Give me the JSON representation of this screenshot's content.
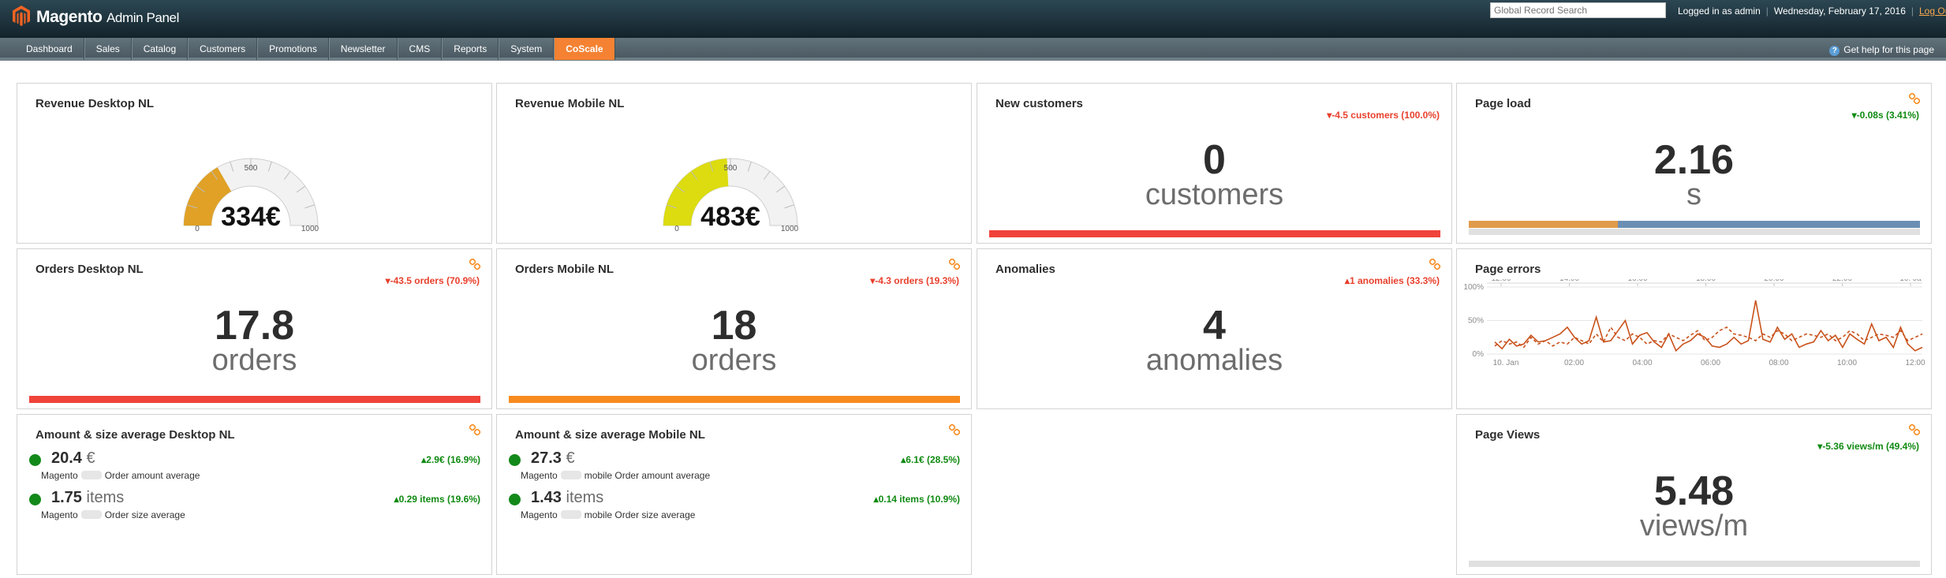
{
  "header": {
    "logo_brand": "Magento",
    "logo_sub": "Admin Panel",
    "search_placeholder": "Global Record Search",
    "logged_in": "Logged in as admin",
    "date": "Wednesday, February 17, 2016",
    "logout": "Log Out"
  },
  "nav": {
    "items": [
      "Dashboard",
      "Sales",
      "Catalog",
      "Customers",
      "Promotions",
      "Newsletter",
      "CMS",
      "Reports",
      "System",
      "CoScale"
    ],
    "active": "CoScale",
    "help": "Get help for this page"
  },
  "colors": {
    "accent": "#f48232",
    "red": "#f0433a",
    "orange": "#f78b1f",
    "green": "#0f8a12",
    "blue": "#6b8fb3"
  },
  "panels": {
    "rev_desktop": {
      "title": "Revenue Desktop NL",
      "value": "334€",
      "min": "0",
      "mid": "500",
      "max": "1000",
      "gauge_value": 334,
      "gauge_max": 1000,
      "color": "#e0a126"
    },
    "rev_mobile": {
      "title": "Revenue Mobile NL",
      "value": "483€",
      "min": "0",
      "mid": "500",
      "max": "1000",
      "gauge_value": 483,
      "gauge_max": 1000,
      "color": "#dcdc10"
    },
    "new_customers": {
      "title": "New customers",
      "delta": "-4.5 customers (100.0%)",
      "value": "0",
      "unit": "customers"
    },
    "page_load": {
      "title": "Page load",
      "delta": "-0.08s (3.41%)",
      "value": "2.16",
      "unit": "s",
      "bar_split": 0.33
    },
    "orders_desktop": {
      "title": "Orders Desktop NL",
      "delta": "-43.5 orders (70.9%)",
      "value": "17.8",
      "unit": "orders"
    },
    "orders_mobile": {
      "title": "Orders Mobile NL",
      "delta": "-4.3 orders (19.3%)",
      "value": "18",
      "unit": "orders"
    },
    "anomalies": {
      "title": "Anomalies",
      "delta": "1 anomalies (33.3%)",
      "value": "4",
      "unit": "anomalies"
    },
    "page_errors": {
      "title": "Page errors"
    },
    "amount_desktop": {
      "title": "Amount & size average Desktop NL",
      "rows": [
        {
          "value": "20.4",
          "unit": "€",
          "label_a": "Magento",
          "label_b": "Order amount average",
          "delta": "2.9€ (16.9%)"
        },
        {
          "value": "1.75",
          "unit": "items",
          "label_a": "Magento",
          "label_b": "Order size average",
          "delta": "0.29 items (19.6%)"
        }
      ]
    },
    "amount_mobile": {
      "title": "Amount & size average Mobile NL",
      "rows": [
        {
          "value": "27.3",
          "unit": "€",
          "label_a": "Magento",
          "label_b": "mobile Order amount average",
          "delta": "6.1€ (28.5%)"
        },
        {
          "value": "1.43",
          "unit": "items",
          "label_a": "Magento",
          "label_b": "mobile Order size average",
          "delta": "0.14 items (10.9%)"
        }
      ]
    },
    "page_views": {
      "title": "Page Views",
      "delta": "-5.36 views/m (49.4%)",
      "value": "5.48",
      "unit": "views/m"
    }
  },
  "chart_data": {
    "type": "line",
    "x_top_ticks": [
      "12:00",
      "14:00",
      "16:00",
      "18:00",
      "20:00",
      "22:00",
      "10. Ja"
    ],
    "x_bottom_ticks": [
      "10. Jan",
      "02:00",
      "04:00",
      "06:00",
      "08:00",
      "10:00",
      "12:00"
    ],
    "y_ticks": [
      "100%",
      "50%",
      "0%"
    ],
    "ylim": [
      0,
      100
    ],
    "series": [
      {
        "style": "solid",
        "color": "#c9521b",
        "values": [
          18,
          8,
          22,
          12,
          15,
          28,
          18,
          20,
          25,
          30,
          40,
          25,
          15,
          20,
          55,
          18,
          20,
          35,
          50,
          15,
          28,
          32,
          18,
          10,
          30,
          5,
          15,
          20,
          30,
          25,
          12,
          10,
          15,
          25,
          15,
          20,
          80,
          22,
          18,
          40,
          22,
          30,
          10,
          15,
          18,
          35,
          20,
          28,
          10,
          30,
          22,
          15,
          45,
          20,
          25,
          10,
          40,
          15,
          5,
          10
        ]
      },
      {
        "style": "dashed",
        "color": "#c9521b",
        "values": [
          12,
          20,
          15,
          18,
          10,
          25,
          15,
          20,
          12,
          18,
          15,
          25,
          20,
          15,
          30,
          18,
          40,
          25,
          20,
          30,
          25,
          15,
          20,
          18,
          30,
          25,
          20,
          28,
          35,
          20,
          25,
          35,
          40,
          30,
          28,
          25,
          20,
          30,
          25,
          35,
          30,
          20,
          25,
          30,
          28,
          25,
          30,
          20,
          25,
          35,
          30,
          20,
          25,
          30,
          28,
          25,
          35,
          20,
          25,
          30
        ]
      }
    ]
  }
}
